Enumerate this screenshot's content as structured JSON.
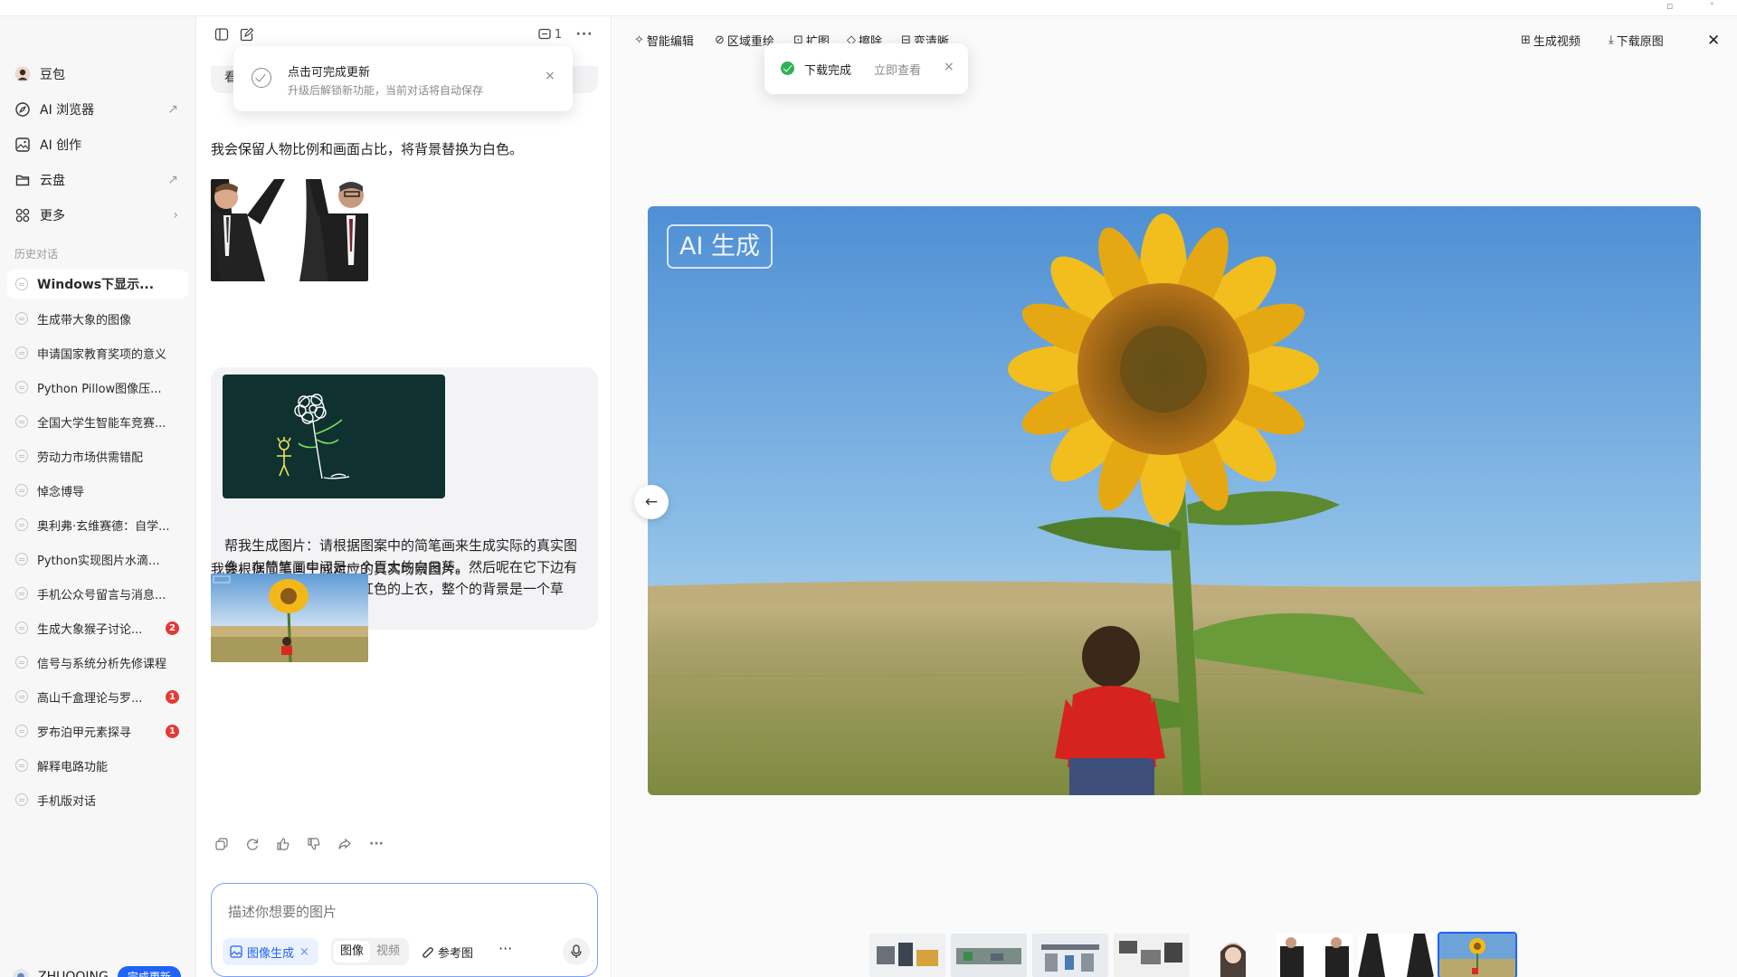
{
  "sidebar": {
    "nav": [
      {
        "label": "豆包",
        "icon": "doubao-avatar-icon"
      },
      {
        "label": "AI 浏览器",
        "icon": "compass-icon",
        "arrow": "↗"
      },
      {
        "label": "AI 创作",
        "icon": "image-icon"
      },
      {
        "label": "云盘",
        "icon": "folder-icon",
        "arrow": "↗"
      },
      {
        "label": "更多",
        "icon": "grid-icon",
        "arrow": "›"
      }
    ],
    "history_label": "历史对话",
    "history": [
      {
        "label": "Windows下显示...",
        "active": true
      },
      {
        "label": "生成带大象的图像"
      },
      {
        "label": "申请国家教育奖项的意义"
      },
      {
        "label": "Python Pillow图像压..."
      },
      {
        "label": "全国大学生智能车竞赛..."
      },
      {
        "label": "劳动力市场供需错配"
      },
      {
        "label": "悼念博导"
      },
      {
        "label": "奥利弗·玄维赛德：自学..."
      },
      {
        "label": "Python实现图片水滴..."
      },
      {
        "label": "手机公众号留言与消息..."
      },
      {
        "label": "生成大象猴子讨论...",
        "badge": "2"
      },
      {
        "label": "信号与系统分析先修课程"
      },
      {
        "label": "高山千盒理论与罗...",
        "badge": "1"
      },
      {
        "label": "罗布泊甲元素探寻",
        "badge": "1"
      },
      {
        "label": "解释电路功能"
      },
      {
        "label": "手机版对话"
      }
    ],
    "user": {
      "name": "ZHUOQING",
      "update_button": "完成更新"
    }
  },
  "chat": {
    "toolbar": {
      "count": "1"
    },
    "cut_text": "看",
    "toast": {
      "title": "点击可完成更新",
      "subtitle": "升级后解锁新功能，当前对话将自动保存",
      "close": "×"
    },
    "msg1": "我会保留人物比例和画面占比，将背景替换为白色。",
    "user_prompt": "帮我生成图片：请根据图案中的简笔画来生成实际的真实图像，在简笔画中间是一个巨大的向日葵。然后呢在它下边有一个人物，小孩，穿着红色的上衣，整个的背景是一个草原，请生成16:9的图片。",
    "msg2": "我会根据简笔画生成对应的真实场景图片。",
    "composer": {
      "placeholder": "描述你想要的图片",
      "chip": "图像生成",
      "chip_close": "×",
      "seg_image": "图像",
      "seg_video": "视频",
      "ref": "参考图",
      "more": "···"
    }
  },
  "viewer": {
    "tools": [
      {
        "label": "智能编辑",
        "icon": "sparkle-icon"
      },
      {
        "label": "区域重绘",
        "icon": "brush-icon"
      },
      {
        "label": "扩图",
        "icon": "expand-icon"
      },
      {
        "label": "擦除",
        "icon": "eraser-icon"
      },
      {
        "label": "变清晰",
        "icon": "hd-icon"
      }
    ],
    "right_tools": [
      {
        "label": "生成视频",
        "icon": "video-icon"
      },
      {
        "label": "下载原图",
        "icon": "download-icon"
      }
    ],
    "download_toast": {
      "title": "下载完成",
      "action": "立即查看",
      "close": "×"
    },
    "ai_tag": "AI 生成",
    "prev": "←"
  },
  "colors": {
    "accent": "#1f64f6",
    "badge": "#e53935",
    "success": "#2fb257"
  }
}
